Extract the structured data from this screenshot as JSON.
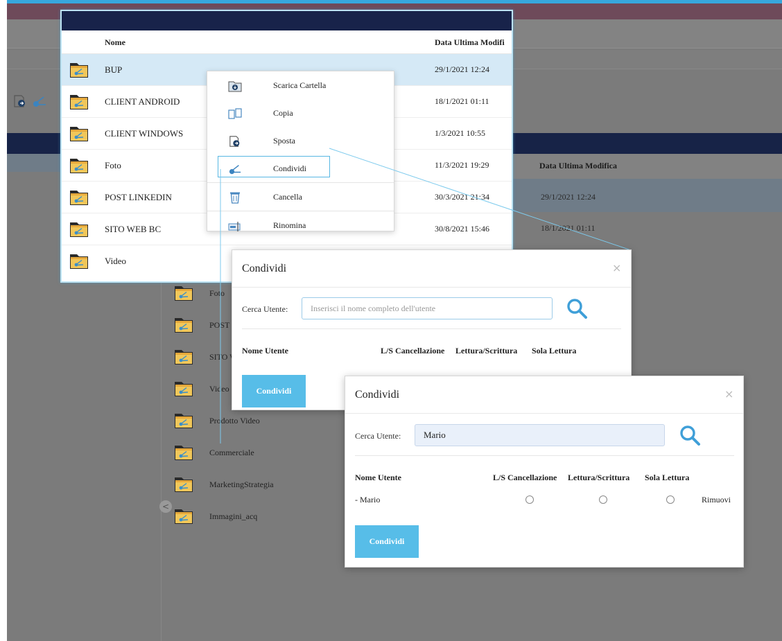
{
  "colors": {
    "accent": "#57bde8",
    "navy": "#18234a",
    "selection": "#d5e9f6",
    "accent_line": "#37a7dd"
  },
  "folder_popup": {
    "col_name": "Nome",
    "col_date": "Data Ultima Modifi",
    "rows": [
      {
        "name": "BUP",
        "date": "29/1/2021 12:24"
      },
      {
        "name": "CLIENT ANDROID",
        "date": "18/1/2021 01:11"
      },
      {
        "name": "CLIENT WINDOWS",
        "date": "1/3/2021 10:55"
      },
      {
        "name": "Foto",
        "date": "11/3/2021 19:29"
      },
      {
        "name": "POST LINKEDIN",
        "date": "30/3/2021 21:34"
      },
      {
        "name": "SITO WEB BC",
        "date": "30/8/2021 15:46"
      },
      {
        "name": "Video",
        "date": ""
      }
    ]
  },
  "context_menu": {
    "items": [
      {
        "label": "Scarica Cartella",
        "icon": "download-folder-icon"
      },
      {
        "label": "Copia",
        "icon": "copy-icon"
      },
      {
        "label": "Sposta",
        "icon": "move-icon"
      },
      {
        "label": "Condividi",
        "icon": "share-icon"
      },
      {
        "label": "Cancella",
        "icon": "trash-icon"
      },
      {
        "label": "Rinomina",
        "icon": "rename-icon"
      }
    ]
  },
  "background": {
    "header_date": "Data Ultima Modifica",
    "row_dates": [
      "29/1/2021 12:24",
      "18/1/2021 01:11"
    ],
    "items": [
      "Foto",
      "POST LI",
      "SITO W",
      "Video",
      "Prodotto Video",
      "Commerciale",
      "MarketingStrategia",
      "Immagini_acq"
    ],
    "collapse_glyph": "<"
  },
  "share_modal_1": {
    "title": "Condividi",
    "close": "×",
    "search_label": "Cerca Utente:",
    "search_placeholder": "Inserisci il nome completo dell'utente",
    "col_user": "Nome Utente",
    "col_ls": "L/S Cancellazione",
    "col_rw": "Lettura/Scrittura",
    "col_ro": "Sola Lettura",
    "button": "Condividi"
  },
  "share_modal_2": {
    "title": "Condividi",
    "close": "×",
    "search_label": "Cerca Utente:",
    "search_value": "Mario",
    "col_user": "Nome Utente",
    "col_ls": "L/S Cancellazione",
    "col_rw": "Lettura/Scrittura",
    "col_ro": "Sola Lettura",
    "user_row": {
      "name": "- Mario",
      "remove": "Rimuovi"
    },
    "button": "Condividi"
  }
}
